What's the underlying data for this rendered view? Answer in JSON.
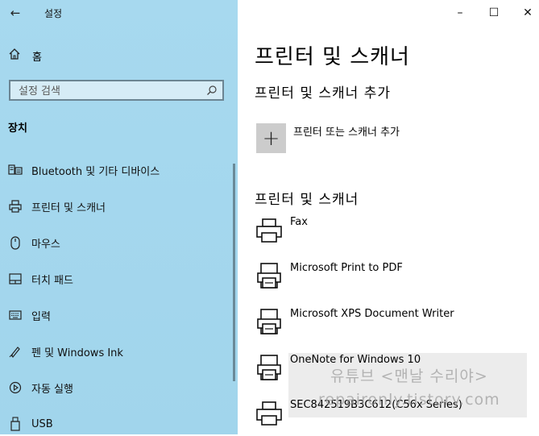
{
  "app": {
    "title": "설정"
  },
  "sidebar": {
    "home_label": "홈",
    "search_placeholder": "설정 검색",
    "section_title": "장치",
    "items": [
      {
        "label": "Bluetooth 및 기타 디바이스",
        "icon": "bluetooth-devices-icon"
      },
      {
        "label": "프린터 및 스캐너",
        "icon": "printer-icon"
      },
      {
        "label": "마우스",
        "icon": "mouse-icon"
      },
      {
        "label": "터치 패드",
        "icon": "touchpad-icon"
      },
      {
        "label": "입력",
        "icon": "keyboard-icon"
      },
      {
        "label": "펜 및 Windows Ink",
        "icon": "pen-icon"
      },
      {
        "label": "자동 실행",
        "icon": "autoplay-icon"
      },
      {
        "label": "USB",
        "icon": "usb-icon"
      }
    ]
  },
  "main": {
    "title": "프린터 및 스캐너",
    "add_section_title": "프린터 및 스캐너 추가",
    "add_button_label": "프린터 또는 스캐너 추가",
    "list_section_title": "프린터 및 스캐너",
    "devices": [
      {
        "name": "Fax",
        "icon": "fax-printer-icon"
      },
      {
        "name": "Microsoft Print to PDF",
        "icon": "pdf-printer-icon"
      },
      {
        "name": "Microsoft XPS Document Writer",
        "icon": "xps-printer-icon"
      },
      {
        "name": "OneNote for Windows 10",
        "icon": "onenote-printer-icon"
      },
      {
        "name": "SEC842519B3C612(C56x Series)",
        "icon": "printer-icon"
      }
    ]
  },
  "watermark": {
    "line1": "유튜브 <맨날 수리야>",
    "line2": "repaironly.tistory.com"
  }
}
